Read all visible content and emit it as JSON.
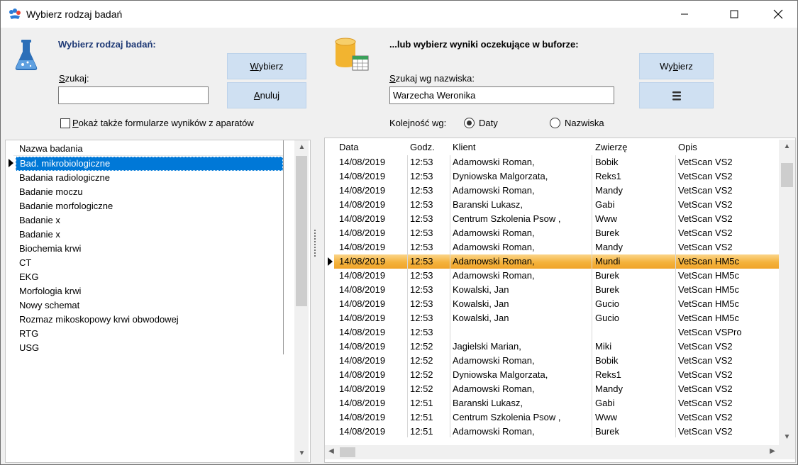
{
  "window": {
    "title": "Wybierz rodzaj badań",
    "controls": [
      "minimize",
      "maximize",
      "close"
    ]
  },
  "left": {
    "header": "Wybierz rodzaj badań:",
    "search_label_first": "S",
    "search_label_rest": "zukaj:",
    "search_value": "",
    "buttons": {
      "choose_first": "W",
      "choose_rest": "ybierz",
      "cancel_first": "A",
      "cancel_rest": "nuluj"
    },
    "checkbox_first": "P",
    "checkbox_rest": "okaż także formularze wyników z aparatów",
    "checkbox_checked": false,
    "list_header": "Nazwa badania",
    "items": [
      "Bad. mikrobiologiczne",
      "Badania radiologiczne",
      "Badanie moczu",
      "Badanie morfologiczne",
      "Badanie x",
      "Badanie x",
      "Biochemia krwi",
      "CT",
      "EKG",
      "Morfologia krwi",
      "Nowy schemat",
      "Rozmaz mikoskopowy krwi obwodowej",
      "RTG",
      "USG"
    ],
    "selected_index": 0
  },
  "right": {
    "header": "...lub wybierz wyniki oczekujące w buforze:",
    "search_label_first": "S",
    "search_label_rest": "zukaj wg nazwiska:",
    "search_value": "Warzecha Weronika",
    "choose_prefix": "Wy",
    "choose_underlined": "b",
    "choose_suffix": "ierz",
    "order_label": "Kolejność wg:",
    "order_options": [
      "Daty",
      "Nazwiska"
    ],
    "order_selected": "Daty",
    "columns": [
      "Data",
      "Godz.",
      "Klient",
      "Zwierzę",
      "Opis"
    ],
    "rows": [
      [
        "14/08/2019",
        "12:53",
        "Adamowski Roman,",
        "Bobik",
        "VetScan VS2"
      ],
      [
        "14/08/2019",
        "12:53",
        "Dyniowska Malgorzata,",
        "Reks1",
        "VetScan VS2"
      ],
      [
        "14/08/2019",
        "12:53",
        "Adamowski Roman,",
        "Mandy",
        "VetScan VS2"
      ],
      [
        "14/08/2019",
        "12:53",
        "Baranski Lukasz,",
        "Gabi",
        "VetScan VS2"
      ],
      [
        "14/08/2019",
        "12:53",
        "Centrum Szkolenia Psow ,",
        "Www",
        "VetScan VS2"
      ],
      [
        "14/08/2019",
        "12:53",
        "Adamowski Roman,",
        "Burek",
        "VetScan VS2"
      ],
      [
        "14/08/2019",
        "12:53",
        "Adamowski Roman,",
        "Mandy",
        "VetScan VS2"
      ],
      [
        "14/08/2019",
        "12:53",
        "Adamowski Roman,",
        "Mundi",
        "VetScan HM5c"
      ],
      [
        "14/08/2019",
        "12:53",
        "Adamowski Roman,",
        "Burek",
        "VetScan HM5c"
      ],
      [
        "14/08/2019",
        "12:53",
        "Kowalski, Jan",
        "Burek",
        "VetScan HM5c"
      ],
      [
        "14/08/2019",
        "12:53",
        "Kowalski, Jan",
        "Gucio",
        "VetScan HM5c"
      ],
      [
        "14/08/2019",
        "12:53",
        "Kowalski, Jan",
        "Gucio",
        "VetScan HM5c"
      ],
      [
        "14/08/2019",
        "12:53",
        "",
        "",
        "VetScan VSPro"
      ],
      [
        "14/08/2019",
        "12:52",
        "Jagielski Marian,",
        "Miki",
        "VetScan VS2"
      ],
      [
        "14/08/2019",
        "12:52",
        "Adamowski Roman,",
        "Bobik",
        "VetScan VS2"
      ],
      [
        "14/08/2019",
        "12:52",
        "Dyniowska Malgorzata,",
        "Reks1",
        "VetScan VS2"
      ],
      [
        "14/08/2019",
        "12:52",
        "Adamowski Roman,",
        "Mandy",
        "VetScan VS2"
      ],
      [
        "14/08/2019",
        "12:51",
        "Baranski Lukasz,",
        "Gabi",
        "VetScan VS2"
      ],
      [
        "14/08/2019",
        "12:51",
        "Centrum Szkolenia Psow ,",
        "Www",
        "VetScan VS2"
      ],
      [
        "14/08/2019",
        "12:51",
        "Adamowski Roman,",
        "Burek",
        "VetScan VS2"
      ]
    ],
    "selected_row": 7
  },
  "colors": {
    "accent_blue": "#0078d7",
    "header_text": "#1f3a76",
    "button_bg": "#cfe0f2",
    "row_highlight": "#f4b23c"
  },
  "icons": [
    "app-icon",
    "flask-icon",
    "database-icon",
    "hamburger-menu-icon",
    "row-indicator-icon"
  ]
}
